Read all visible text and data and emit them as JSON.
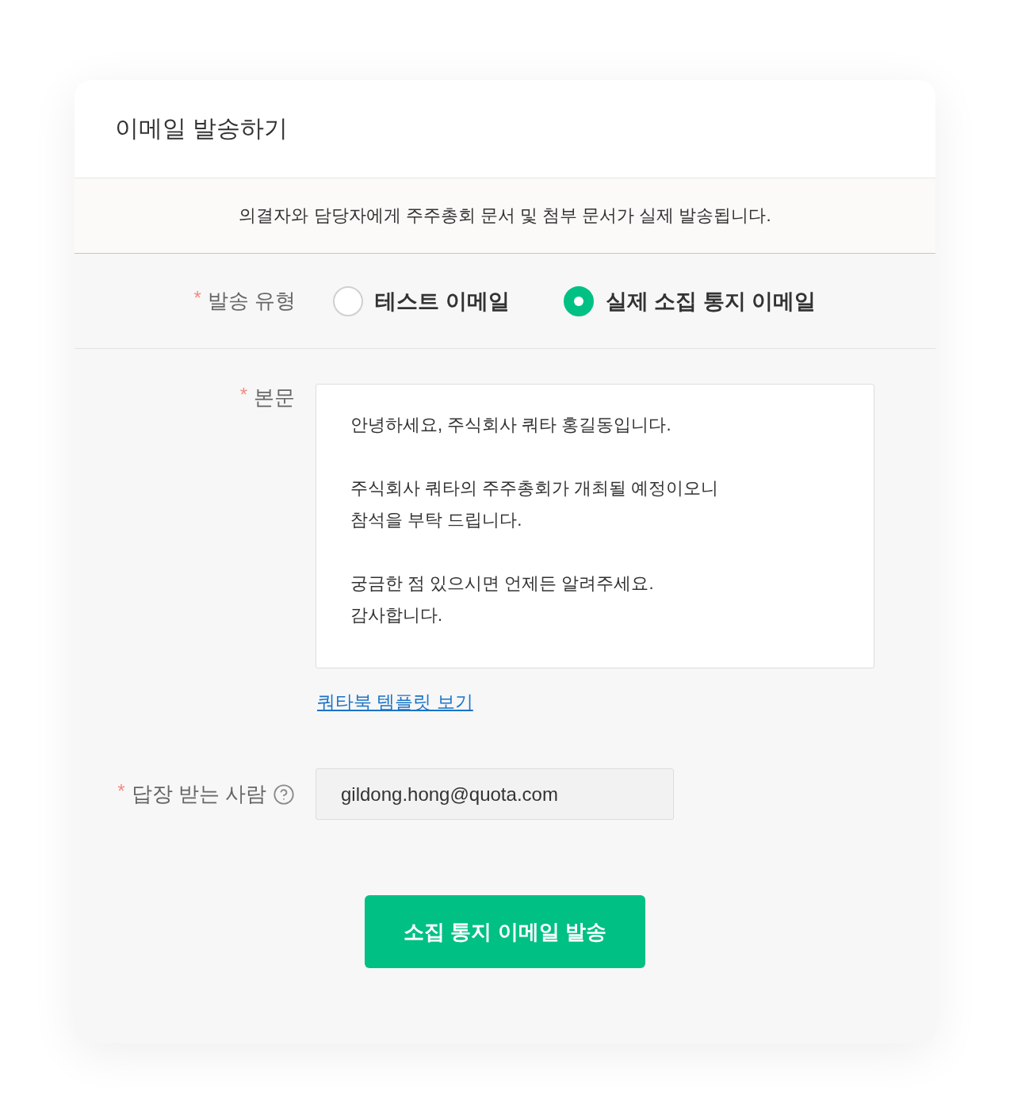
{
  "dialog": {
    "title": "이메일 발송하기"
  },
  "notice": "의결자와 담당자에게 주주총회 문서 및 첨부 문서가 실제 발송됩니다.",
  "send_type": {
    "required_mark": "*",
    "label": "발송 유형",
    "options": [
      {
        "label": "테스트 이메일",
        "selected": false
      },
      {
        "label": "실제 소집 통지 이메일",
        "selected": true
      }
    ]
  },
  "body": {
    "required_mark": "*",
    "label": "본문",
    "value": "안녕하세요, 주식회사 쿼타 홍길동입니다.\n\n주식회사 쿼타의 주주총회가 개최될 예정이오니\n참석을 부탁 드립니다.\n\n궁금한 점 있으시면 언제든 알려주세요.\n감사합니다.",
    "template_link": "쿼타북 템플릿 보기"
  },
  "reply_to": {
    "required_mark": "*",
    "label": "답장 받는 사람",
    "value": "gildong.hong@quota.com"
  },
  "submit_button": "소집 통지 이메일 발송"
}
